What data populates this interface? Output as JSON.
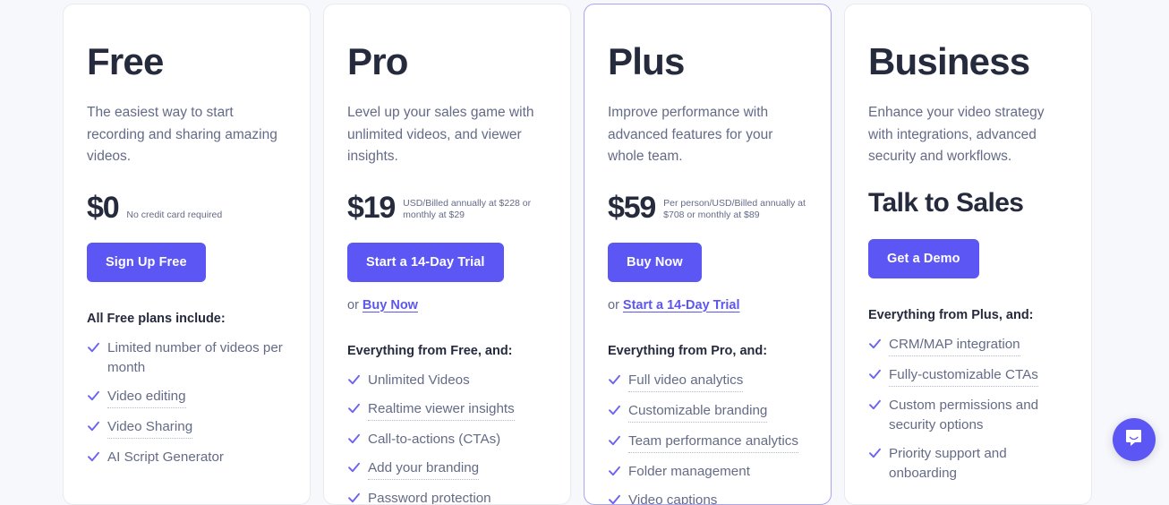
{
  "page": {
    "background_color": "#f7f8fb",
    "accent_color": "#5c56f5",
    "heading_color": "#252a3d",
    "muted_text_color": "#646b87",
    "highlight_border_color": "#a9a4f6"
  },
  "plans": [
    {
      "name": "Free",
      "description": "The easiest way to start recording and sharing amazing videos.",
      "price": "$0",
      "price_note": "No credit card required",
      "cta_label": "Sign Up Free",
      "secondary_prefix": "",
      "secondary_link": "",
      "features_heading": "All Free plans include:",
      "features": [
        {
          "label": "Limited number of videos per month",
          "tooltip": false
        },
        {
          "label": "Video editing",
          "tooltip": true
        },
        {
          "label": "Video Sharing",
          "tooltip": true
        },
        {
          "label": "AI Script Generator",
          "tooltip": false
        }
      ],
      "highlighted": false
    },
    {
      "name": "Pro",
      "description": "Level up your sales game with unlimited videos, and viewer insights.",
      "price": "$19",
      "price_note": "USD/Billed annually at $228 or monthly at $29",
      "cta_label": "Start a 14-Day Trial",
      "secondary_prefix": "or ",
      "secondary_link": "Buy Now",
      "features_heading": "Everything from Free, and:",
      "features": [
        {
          "label": "Unlimited Videos",
          "tooltip": false
        },
        {
          "label": "Realtime viewer insights",
          "tooltip": true
        },
        {
          "label": "Call-to-actions (CTAs)",
          "tooltip": false
        },
        {
          "label": "Add your branding",
          "tooltip": true
        },
        {
          "label": "Password protection",
          "tooltip": false
        }
      ],
      "highlighted": false
    },
    {
      "name": "Plus",
      "description": "Improve performance with advanced features for your whole team.",
      "price": "$59",
      "price_note": "Per person/USD/Billed annually at $708 or monthly at $89",
      "cta_label": "Buy Now",
      "secondary_prefix": "or ",
      "secondary_link": "Start a 14-Day Trial",
      "features_heading": "Everything from Pro, and:",
      "features": [
        {
          "label": "Full video analytics",
          "tooltip": true
        },
        {
          "label": "Customizable branding",
          "tooltip": true
        },
        {
          "label": "Team performance analytics",
          "tooltip": true
        },
        {
          "label": "Folder management",
          "tooltip": false
        },
        {
          "label": "Video captions",
          "tooltip": false
        }
      ],
      "highlighted": true
    },
    {
      "name": "Business",
      "description": "Enhance your video strategy with integrations, advanced security and workflows.",
      "price": "",
      "price_note": "",
      "sales_heading": "Talk to Sales",
      "cta_label": "Get a Demo",
      "secondary_prefix": "",
      "secondary_link": "",
      "features_heading": "Everything from Plus, and:",
      "features": [
        {
          "label": "CRM/MAP integration",
          "tooltip": true
        },
        {
          "label": "Fully-customizable CTAs",
          "tooltip": true
        },
        {
          "label": "Custom permissions and security options",
          "tooltip": false
        },
        {
          "label": "Priority support and onboarding",
          "tooltip": false
        }
      ],
      "highlighted": false
    }
  ],
  "chat_widget": {
    "icon": "chat-bubble-icon",
    "color": "#5c56f5"
  }
}
